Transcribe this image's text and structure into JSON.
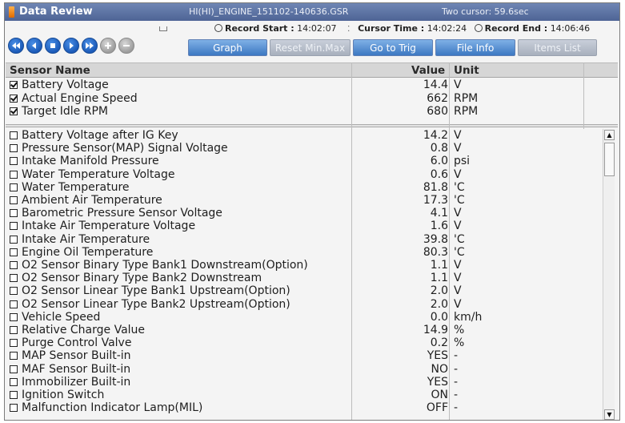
{
  "window": {
    "title": "Data Review",
    "file_name": "HI(HI)_ENGINE_151102-140636.GSR",
    "cursor_mode": "Two cursor: 59.6sec"
  },
  "record_info": {
    "start_label": "Record Start :",
    "start_time": "14:02:07",
    "cursor_label": "Cursor Time :",
    "cursor_time": "14:02:24",
    "end_label": "Record End :",
    "end_time": "14:06:46"
  },
  "nav_buttons": [
    {
      "name": "first-record-button",
      "icon": "double-left-icon"
    },
    {
      "name": "previous-button",
      "icon": "left-icon"
    },
    {
      "name": "stop-button",
      "icon": "stop-icon"
    },
    {
      "name": "play-button",
      "icon": "right-icon"
    },
    {
      "name": "last-record-button",
      "icon": "double-right-icon"
    },
    {
      "name": "zoom-in-button",
      "icon": "plus-icon"
    },
    {
      "name": "zoom-out-button",
      "icon": "minus-icon"
    }
  ],
  "tabs": {
    "graph": "Graph",
    "reset_min_max": "Reset Min.Max",
    "go_to_trig": "Go to Trig",
    "file_info": "File Info",
    "items_list": "Items List"
  },
  "table": {
    "columns": {
      "sensor": "Sensor Name",
      "value": "Value",
      "unit": "Unit"
    },
    "pinned_rows": [
      {
        "name": "Battery Voltage",
        "value": "14.4",
        "unit": "V",
        "checked": true
      },
      {
        "name": "Actual Engine Speed",
        "value": "662",
        "unit": "RPM",
        "checked": true
      },
      {
        "name": "Target Idle RPM",
        "value": "680",
        "unit": "RPM",
        "checked": true
      }
    ],
    "rows": [
      {
        "name": "Battery Voltage after IG Key",
        "value": "14.2",
        "unit": "V"
      },
      {
        "name": "Pressure Sensor(MAP) Signal Voltage",
        "value": "0.8",
        "unit": "V"
      },
      {
        "name": "Intake Manifold Pressure",
        "value": "6.0",
        "unit": "psi"
      },
      {
        "name": "Water Temperature Voltage",
        "value": "0.6",
        "unit": "V"
      },
      {
        "name": "Water Temperature",
        "value": "81.8",
        "unit": "'C"
      },
      {
        "name": "Ambient Air Temperature",
        "value": "17.3",
        "unit": "'C"
      },
      {
        "name": "Barometric Pressure Sensor Voltage",
        "value": "4.1",
        "unit": "V"
      },
      {
        "name": "Intake Air Temperature Voltage",
        "value": "1.6",
        "unit": "V"
      },
      {
        "name": "Intake Air Temperature",
        "value": "39.8",
        "unit": "'C"
      },
      {
        "name": "Engine Oil Temperature",
        "value": "80.3",
        "unit": "'C"
      },
      {
        "name": "O2 Sensor Binary Type Bank1 Downstream(Option)",
        "value": "1.1",
        "unit": "V"
      },
      {
        "name": "O2 Sensor Binary Type Bank2 Downstream",
        "value": "1.1",
        "unit": "V"
      },
      {
        "name": "O2 Sensor Linear Type Bank1 Upstream(Option)",
        "value": "2.0",
        "unit": "V"
      },
      {
        "name": "O2 Sensor Linear Type Bank2 Upstream(Option)",
        "value": "2.0",
        "unit": "V"
      },
      {
        "name": "Vehicle Speed",
        "value": "0.0",
        "unit": "km/h"
      },
      {
        "name": "Relative Charge Value",
        "value": "14.9",
        "unit": "%"
      },
      {
        "name": "Purge Control Valve",
        "value": "0.2",
        "unit": "%"
      },
      {
        "name": "MAP Sensor Built-in",
        "value": "YES",
        "unit": "-"
      },
      {
        "name": "MAF Sensor Built-in",
        "value": "NO",
        "unit": "-"
      },
      {
        "name": "Immobilizer Built-in",
        "value": "YES",
        "unit": "-"
      },
      {
        "name": "Ignition Switch",
        "value": "ON",
        "unit": "-"
      },
      {
        "name": "Malfunction Indicator Lamp(MIL)",
        "value": "OFF",
        "unit": "-"
      }
    ]
  },
  "colors": {
    "title_bar": "#5a70a2",
    "button_blue": "#3c78c2",
    "button_disabled": "#a8b0bd",
    "header_bg": "#d6d6d6"
  }
}
